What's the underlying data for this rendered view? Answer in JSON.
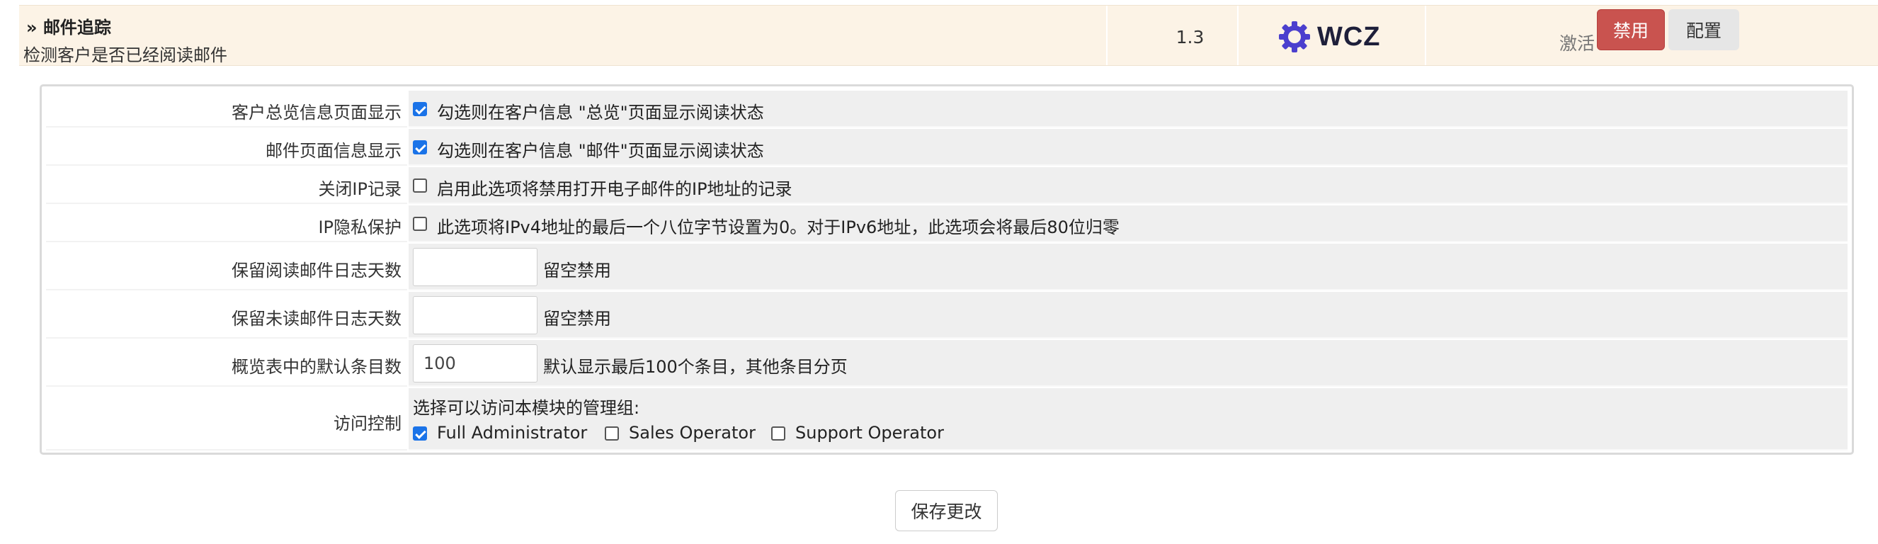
{
  "module": {
    "name": "» 邮件追踪",
    "description": "检测客户是否已经阅读邮件",
    "version": "1.3",
    "vendor_logo_text": "WCZ",
    "status": "激活",
    "disable_label": "禁用",
    "config_label": "配置"
  },
  "settings": {
    "rows": [
      {
        "label": "客户总览信息页面显示",
        "type": "checkbox",
        "checked": true,
        "text": "勾选则在客户信息 \"总览\"页面显示阅读状态"
      },
      {
        "label": "邮件页面信息显示",
        "type": "checkbox",
        "checked": true,
        "text": "勾选则在客户信息 \"邮件\"页面显示阅读状态"
      },
      {
        "label": "关闭IP记录",
        "type": "checkbox",
        "checked": false,
        "text": "启用此选项将禁用打开电子邮件的IP地址的记录"
      },
      {
        "label": "IP隐私保护",
        "type": "checkbox",
        "checked": false,
        "text": "此选项将IPv4地址的最后一个八位字节设置为0。对于IPv6地址，此选项会将最后80位归零"
      },
      {
        "label": "保留阅读邮件日志天数",
        "type": "input",
        "value": "",
        "text": "留空禁用"
      },
      {
        "label": "保留未读邮件日志天数",
        "type": "input",
        "value": "",
        "text": "留空禁用"
      },
      {
        "label": "概览表中的默认条目数",
        "type": "input",
        "value": "100",
        "text": "默认显示最后100个条目，其他条目分页"
      }
    ],
    "access": {
      "label": "访问控制",
      "prompt": "选择可以访问本模块的管理组:",
      "groups": [
        {
          "name": "Full Administrator",
          "checked": true
        },
        {
          "name": "Sales Operator",
          "checked": false
        },
        {
          "name": "Support Operator",
          "checked": false
        }
      ]
    }
  },
  "save_label": "保存更改",
  "colors": {
    "header_bg": "#fcf3e6",
    "danger": "#c9534f",
    "checkbox_accent": "#1a73e8",
    "field_bg": "#efefef"
  }
}
